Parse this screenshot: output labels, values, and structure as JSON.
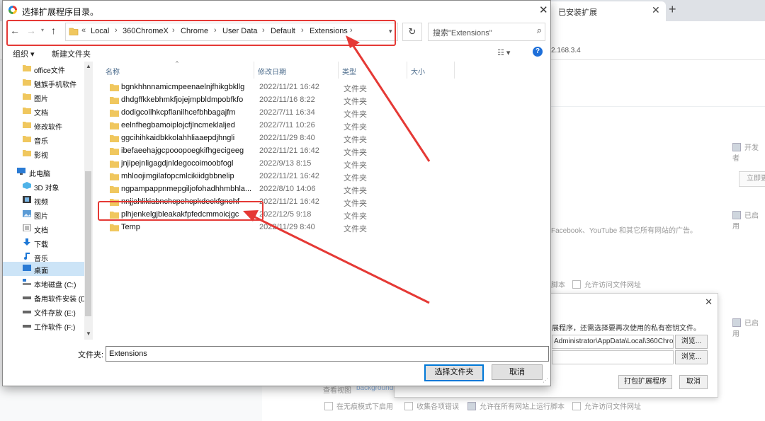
{
  "background": {
    "tab_label": "已安装扩展",
    "url_fragment": "2.168.3.4",
    "right_labels": {
      "developer": "开发者",
      "update": "立即更",
      "enabled_1": "已启用",
      "enabled_2": "已启用"
    },
    "text_facebook": "Facebook、YouTube 和其它所有网站的广告。",
    "text_script": "脚本",
    "allow_file_url": "允许访问文件网址",
    "bottom": {
      "view_label": "查看视图",
      "view_link": "background",
      "incognito": "在无痕模式下启用",
      "collect_errors": "收集各项错误",
      "allow_all_sites": "允许在所有网站上运行脚本",
      "allow_file_url": "允许访问文件网址"
    }
  },
  "pack_dialog": {
    "message": "展程序，还需选择要再次使用的私有密钥文件。",
    "root_path": "Administrator\\AppData\\Local\\360Chro",
    "key_path": "",
    "browse_1": "浏览...",
    "browse_2": "浏览...",
    "pack_button": "打包扩展程序",
    "cancel_button": "取消"
  },
  "file_dialog": {
    "title": "选择扩展程序目录。",
    "breadcrumbs": [
      "Local",
      "360ChromeX",
      "Chrome",
      "User Data",
      "Default",
      "Extensions"
    ],
    "search_placeholder": "搜索\"Extensions\"",
    "toolbar": {
      "organize": "组织 ▾",
      "new_folder": "新建文件夹",
      "view": "▾"
    },
    "nav_items": [
      {
        "label": "office文件",
        "icon": "folder-icon"
      },
      {
        "label": "魅族手机软件",
        "icon": "folder-icon"
      },
      {
        "label": "图片",
        "icon": "folder-icon"
      },
      {
        "label": "文档",
        "icon": "folder-icon"
      },
      {
        "label": "修改软件",
        "icon": "folder-icon"
      },
      {
        "label": "音乐",
        "icon": "folder-icon"
      },
      {
        "label": "影视",
        "icon": "folder-icon"
      },
      {
        "label": "此电脑",
        "icon": "computer-icon"
      },
      {
        "label": "3D 对象",
        "icon": "cube-icon"
      },
      {
        "label": "视频",
        "icon": "video-icon"
      },
      {
        "label": "图片",
        "icon": "picture-icon"
      },
      {
        "label": "文档",
        "icon": "document-icon"
      },
      {
        "label": "下载",
        "icon": "download-icon"
      },
      {
        "label": "音乐",
        "icon": "music-icon"
      },
      {
        "label": "桌面",
        "icon": "desktop-icon"
      },
      {
        "label": "本地磁盘 (C:)",
        "icon": "system-drive-icon"
      },
      {
        "label": "备用软件安装 (D",
        "icon": "drive-icon"
      },
      {
        "label": "文件存放 (E:)",
        "icon": "drive-icon"
      },
      {
        "label": "工作软件 (F:)",
        "icon": "drive-icon"
      }
    ],
    "columns": [
      "名称",
      "修改日期",
      "类型",
      "大小"
    ],
    "files": [
      {
        "name": "bgnkhhnnamicmpeenaelnjfhikgbkllg",
        "date": "2022/11/21 16:42",
        "type": "文件夹"
      },
      {
        "name": "dhdgffkkebhmkfjojejmpbldmpobfkfo",
        "date": "2022/11/16 8:22",
        "type": "文件夹"
      },
      {
        "name": "dodigcollhkcpflanilhcefbhbagajfm",
        "date": "2022/7/11 16:34",
        "type": "文件夹"
      },
      {
        "name": "eelnfhegbamoiplojcfjlncmeklaljed",
        "date": "2022/7/11 10:26",
        "type": "文件夹"
      },
      {
        "name": "ggcihihkaidbkkolahhliaaepdjhngli",
        "date": "2022/11/29 8:40",
        "type": "文件夹"
      },
      {
        "name": "ibefaeehajgcpooopoegkifhgecigeeg",
        "date": "2022/11/21 16:42",
        "type": "文件夹"
      },
      {
        "name": "jnjipejnligagdjnldegocoimoobfogl",
        "date": "2022/9/13 8:15",
        "type": "文件夹"
      },
      {
        "name": "mhloojimgilafopcmlcikiidgbbnelip",
        "date": "2022/11/21 16:42",
        "type": "文件夹"
      },
      {
        "name": "ngpampappnmepgiljofohadhhmbhla...",
        "date": "2022/8/10 14:06",
        "type": "文件夹"
      },
      {
        "name": "nnjjahlikiabnchcpehcpkdeckfgnohf",
        "date": "2022/11/21 16:42",
        "type": "文件夹"
      },
      {
        "name": "plhjenkelgjbleakakfpfedcmmoicjgc",
        "date": "2022/12/5 9:18",
        "type": "文件夹"
      },
      {
        "name": "Temp",
        "date": "2022/11/29 8:40",
        "type": "文件夹"
      }
    ],
    "folder_label": "文件夹:",
    "folder_value": "Extensions",
    "select_button": "选择文件夹",
    "cancel_button": "取消"
  },
  "colors": {
    "highlight": "#e53935",
    "folder": "#f0c75e",
    "selection": "#cce4f7",
    "accent": "#0078d7"
  }
}
